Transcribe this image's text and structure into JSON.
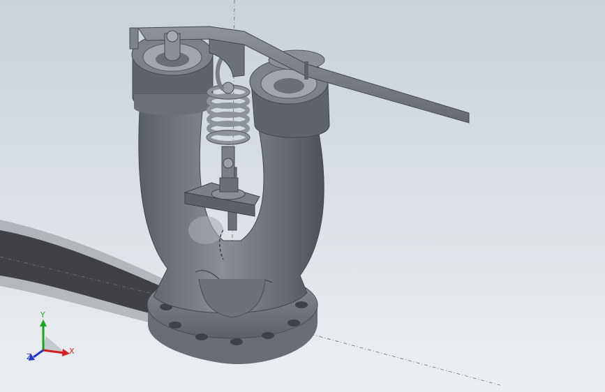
{
  "viewport": {
    "background_top": "#c9d1da",
    "background_bottom": "#eceff2"
  },
  "model": {
    "part_color": "#7c8088",
    "description_icon": "double-outlet-valve-model"
  },
  "triad": {
    "x_label": "X",
    "y_label": "Y",
    "z_label": "Z",
    "x_color": "#d62020",
    "y_color": "#18a818",
    "z_color": "#2038c8"
  }
}
